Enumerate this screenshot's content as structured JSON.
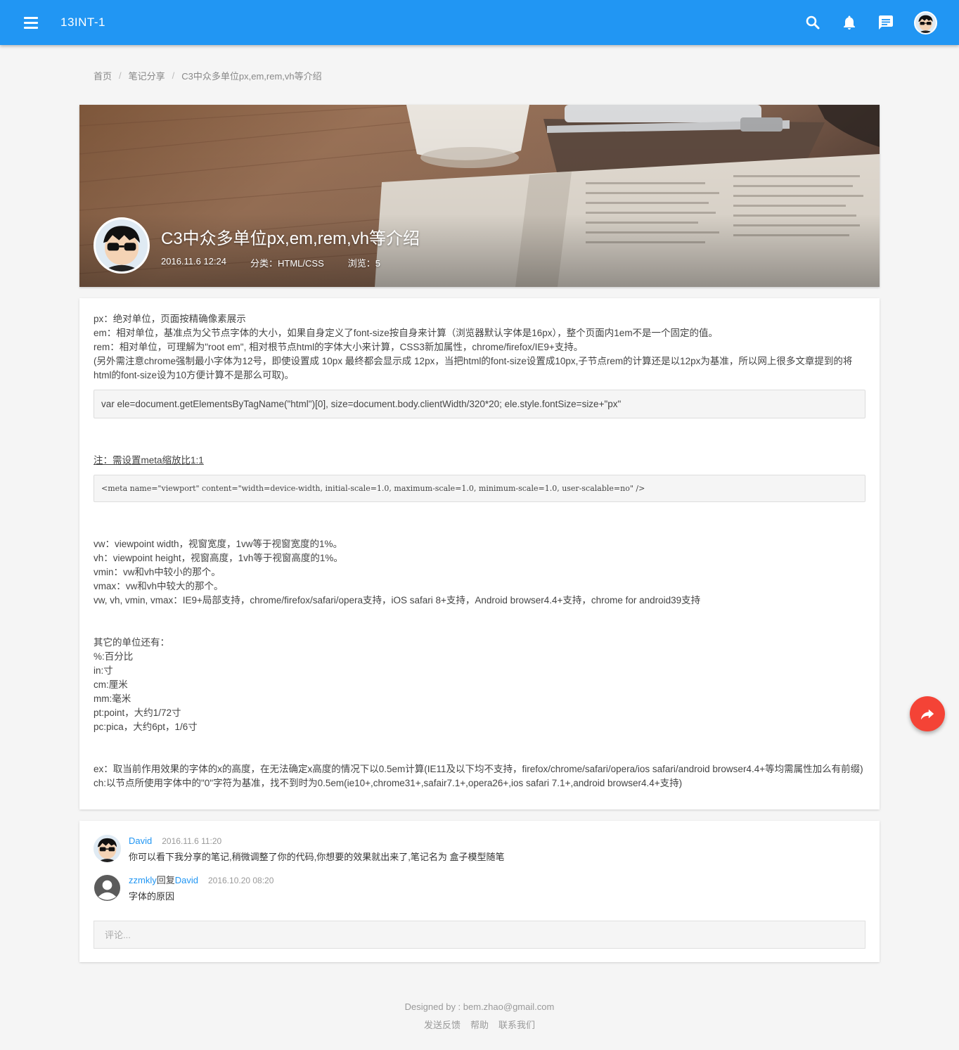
{
  "header": {
    "title": "13INT-1",
    "colors": {
      "bar": "#2196f3",
      "accent": "#f44336"
    },
    "icons": [
      "menu-icon",
      "search-icon",
      "bell-icon",
      "message-icon",
      "avatar"
    ]
  },
  "breadcrumb": [
    "首页",
    "笔记分享",
    "C3中众多单位px,em,rem,vh等介绍"
  ],
  "hero": {
    "title": "C3中众多单位px,em,rem,vh等介绍",
    "date": "2016.11.6 12:24",
    "category": "分类：HTML/CSS",
    "views": "浏览：5"
  },
  "article": {
    "p1": [
      "px：绝对单位，页面按精确像素展示",
      "em：相对单位，基准点为父节点字体的大小，如果自身定义了font-size按自身来计算（浏览器默认字体是16px），整个页面内1em不是一个固定的值。",
      "rem：相对单位，可理解为\"root em\", 相对根节点html的字体大小来计算，CSS3新加属性，chrome/firefox/IE9+支持。",
      "(另外需注意chrome强制最小字体为12号，即使设置成 10px 最终都会显示成 12px，当把html的font-size设置成10px,子节点rem的计算还是以12px为基准，所以网上很多文章提到的将html的font-size设为10方便计算不是那么可取)。"
    ],
    "code1": "var ele=document.getElementsByTagName(\"html\")[0], size=document.body.clientWidth/320*20; ele.style.fontSize=size+\"px\"",
    "note": "注：需设置meta缩放比1:1",
    "code2": "<meta name=\"viewport\" content=\"width=device-width, initial-scale=1.0, maximum-scale=1.0, minimum-scale=1.0, user-scalable=no\" />",
    "p2": [
      "vw：viewpoint width，视窗宽度，1vw等于视窗宽度的1%。",
      "vh：viewpoint height，视窗高度，1vh等于视窗高度的1%。",
      "vmin：vw和vh中较小的那个。",
      "vmax：vw和vh中较大的那个。",
      "vw, vh, vmin, vmax：IE9+局部支持，chrome/firefox/safari/opera支持，iOS safari 8+支持，Android browser4.4+支持，chrome for android39支持"
    ],
    "p3": [
      "其它的单位还有：",
      "%:百分比",
      "in:寸",
      "cm:厘米",
      "mm:毫米",
      "pt:point，大约1/72寸",
      "pc:pica，大约6pt，1/6寸"
    ],
    "p4": [
      "ex：取当前作用效果的字体的x的高度，在无法确定x高度的情况下以0.5em计算(IE11及以下均不支持，firefox/chrome/safari/opera/ios safari/android browser4.4+等均需属性加么有前缀)",
      "ch:以节点所使用字体中的\"0\"字符为基准，找不到时为0.5em(ie10+,chrome31+,safair7.1+,opera26+,ios safari 7.1+,android browser4.4+支持)"
    ]
  },
  "comments": [
    {
      "user": "David",
      "time": "2016.11.6 11:20",
      "text": "你可以看下我分享的笔记,稍微调整了你的代码,你想要的效果就出来了,笔记名为 盒子模型随笔"
    },
    {
      "user": "zzmkly",
      "reply_word": "回复",
      "reply_to": "David",
      "time": "2016.10.20 08:20",
      "text": "字体的原因"
    }
  ],
  "comment_input": {
    "placeholder": "评论..."
  },
  "footer": {
    "designed_by": "Designed by : bem.zhao@gmail.com",
    "links": [
      "发送反馈",
      "帮助",
      "联系我们"
    ]
  }
}
